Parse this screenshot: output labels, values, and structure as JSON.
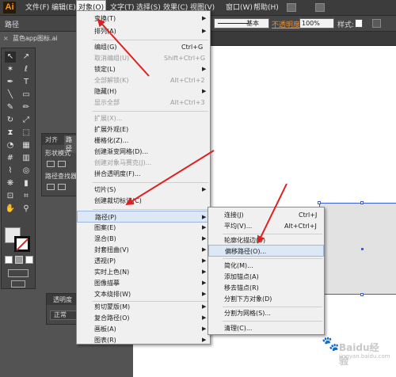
{
  "app": {
    "logo": "Ai",
    "accent": "#ff9a00"
  },
  "menubar": {
    "items": [
      {
        "label": "文件(F)"
      },
      {
        "label": "编辑(E)"
      },
      {
        "label": "对象(O)"
      },
      {
        "label": "文字(T)"
      },
      {
        "label": "选择(S)"
      },
      {
        "label": "效果(C)"
      },
      {
        "label": "视图(V)"
      },
      {
        "label": "窗口(W)"
      },
      {
        "label": "帮助(H)"
      }
    ]
  },
  "control": {
    "path_label": "路径",
    "stroke_style": "基本",
    "opacity_link": "不透明度",
    "opacity_value": "100%",
    "style_label": "样式:"
  },
  "document_tab": {
    "title": "蓝色app图标.ai",
    "close": "×"
  },
  "panels": {
    "panel_a": {
      "tab1": "对齐",
      "tab2": "路径",
      "shape_modes": "形状模式",
      "pathfinder": "路径查找器"
    },
    "panel_b": {
      "title": "透明度",
      "mode": "正常"
    }
  },
  "object_menu": {
    "items": [
      {
        "label": "变换(T)",
        "shortcut": "",
        "submenu": true,
        "enabled": true
      },
      {
        "label": "排列(A)",
        "shortcut": "",
        "submenu": true,
        "enabled": true
      },
      {
        "label": "编组(G)",
        "shortcut": "Ctrl+G",
        "submenu": false,
        "enabled": true
      },
      {
        "label": "取消编组(U)",
        "shortcut": "Shift+Ctrl+G",
        "submenu": false,
        "enabled": false
      },
      {
        "label": "锁定(L)",
        "shortcut": "",
        "submenu": true,
        "enabled": true
      },
      {
        "label": "全部解锁(K)",
        "shortcut": "Alt+Ctrl+2",
        "submenu": false,
        "enabled": false
      },
      {
        "label": "隐藏(H)",
        "shortcut": "",
        "submenu": true,
        "enabled": true
      },
      {
        "label": "显示全部",
        "shortcut": "Alt+Ctrl+3",
        "submenu": false,
        "enabled": false
      },
      {
        "label": "扩展(X)...",
        "shortcut": "",
        "submenu": false,
        "enabled": false
      },
      {
        "label": "扩展外观(E)",
        "shortcut": "",
        "submenu": false,
        "enabled": true
      },
      {
        "label": "栅格化(Z)...",
        "shortcut": "",
        "submenu": false,
        "enabled": true
      },
      {
        "label": "创建渐变网格(D)...",
        "shortcut": "",
        "submenu": false,
        "enabled": true
      },
      {
        "label": "创建对象马赛克(J)...",
        "shortcut": "",
        "submenu": false,
        "enabled": false
      },
      {
        "label": "拼合透明度(F)...",
        "shortcut": "",
        "submenu": false,
        "enabled": true
      },
      {
        "label": "切片(S)",
        "shortcut": "",
        "submenu": true,
        "enabled": true
      },
      {
        "label": "创建裁切标记(C)",
        "shortcut": "",
        "submenu": false,
        "enabled": true
      },
      {
        "label": "路径(P)",
        "shortcut": "",
        "submenu": true,
        "enabled": true
      },
      {
        "label": "图案(E)",
        "shortcut": "",
        "submenu": true,
        "enabled": true
      },
      {
        "label": "混合(B)",
        "shortcut": "",
        "submenu": true,
        "enabled": true
      },
      {
        "label": "封套扭曲(V)",
        "shortcut": "",
        "submenu": true,
        "enabled": true
      },
      {
        "label": "透视(P)",
        "shortcut": "",
        "submenu": true,
        "enabled": true
      },
      {
        "label": "实时上色(N)",
        "shortcut": "",
        "submenu": true,
        "enabled": true
      },
      {
        "label": "图像描摹",
        "shortcut": "",
        "submenu": true,
        "enabled": true
      },
      {
        "label": "文本绕排(W)",
        "shortcut": "",
        "submenu": true,
        "enabled": true
      },
      {
        "label": "剪切蒙版(M)",
        "shortcut": "",
        "submenu": true,
        "enabled": true
      },
      {
        "label": "复合路径(O)",
        "shortcut": "",
        "submenu": true,
        "enabled": true
      },
      {
        "label": "画板(A)",
        "shortcut": "",
        "submenu": true,
        "enabled": true
      },
      {
        "label": "图表(R)",
        "shortcut": "",
        "submenu": true,
        "enabled": true
      }
    ]
  },
  "path_submenu": {
    "items": [
      {
        "label": "连接(J)",
        "shortcut": "Ctrl+J"
      },
      {
        "label": "平均(V)...",
        "shortcut": "Alt+Ctrl+J"
      },
      {
        "label": "轮廓化描边(U)",
        "shortcut": ""
      },
      {
        "label": "偏移路径(O)...",
        "shortcut": ""
      },
      {
        "label": "简化(M)...",
        "shortcut": ""
      },
      {
        "label": "添加锚点(A)",
        "shortcut": ""
      },
      {
        "label": "移去锚点(R)",
        "shortcut": ""
      },
      {
        "label": "分割下方对象(D)",
        "shortcut": ""
      },
      {
        "label": "分割为网格(S)...",
        "shortcut": ""
      },
      {
        "label": "清理(C)...",
        "shortcut": ""
      }
    ]
  },
  "watermark": {
    "text": "Baidu经验",
    "url": "jingyan.baidu.com"
  },
  "colors": {
    "arrow": "#e02020",
    "selection": "#3b5fd6",
    "menu_highlight": "#dde8f6"
  }
}
